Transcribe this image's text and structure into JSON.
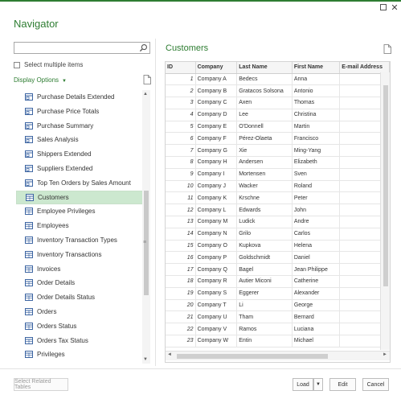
{
  "window": {
    "title": "Navigator",
    "maximize_icon": "maximize-icon",
    "close_glyph": "✕"
  },
  "left": {
    "search": {
      "value": "",
      "placeholder": ""
    },
    "select_multiple_label": "Select multiple items",
    "display_options_label": "Display Options",
    "display_options_caret": "▼",
    "items": [
      {
        "label": "Purchase Details Extended",
        "icon": "view-icon"
      },
      {
        "label": "Purchase Price Totals",
        "icon": "view-icon"
      },
      {
        "label": "Purchase Summary",
        "icon": "view-icon"
      },
      {
        "label": "Sales Analysis",
        "icon": "view-icon"
      },
      {
        "label": "Shippers Extended",
        "icon": "view-icon"
      },
      {
        "label": "Suppliers Extended",
        "icon": "view-icon"
      },
      {
        "label": "Top Ten Orders by Sales Amount",
        "icon": "view-icon"
      },
      {
        "label": "Customers",
        "icon": "table-icon",
        "selected": true
      },
      {
        "label": "Employee Privileges",
        "icon": "table-icon"
      },
      {
        "label": "Employees",
        "icon": "table-icon"
      },
      {
        "label": "Inventory Transaction Types",
        "icon": "table-icon"
      },
      {
        "label": "Inventory Transactions",
        "icon": "table-icon"
      },
      {
        "label": "Invoices",
        "icon": "table-icon"
      },
      {
        "label": "Order Details",
        "icon": "table-icon"
      },
      {
        "label": "Order Details Status",
        "icon": "table-icon"
      },
      {
        "label": "Orders",
        "icon": "table-icon"
      },
      {
        "label": "Orders Status",
        "icon": "table-icon"
      },
      {
        "label": "Orders Tax Status",
        "icon": "table-icon"
      },
      {
        "label": "Privileges",
        "icon": "table-icon"
      }
    ]
  },
  "preview": {
    "title": "Customers",
    "columns": [
      "ID",
      "Company",
      "Last Name",
      "First Name",
      "E-mail Address"
    ],
    "rows": [
      [
        "1",
        "Company A",
        "Bedecs",
        "Anna",
        "..."
      ],
      [
        "2",
        "Company B",
        "Gratacos Solsona",
        "Antonio",
        "..."
      ],
      [
        "3",
        "Company C",
        "Axen",
        "Thomas",
        "..."
      ],
      [
        "4",
        "Company D",
        "Lee",
        "Christina",
        "..."
      ],
      [
        "5",
        "Company E",
        "O'Donnell",
        "Martin",
        "..."
      ],
      [
        "6",
        "Company F",
        "Pérez-Olaeta",
        "Francisco",
        "..."
      ],
      [
        "7",
        "Company G",
        "Xie",
        "Ming-Yang",
        "..."
      ],
      [
        "8",
        "Company H",
        "Andersen",
        "Elizabeth",
        "..."
      ],
      [
        "9",
        "Company I",
        "Mortensen",
        "Sven",
        "..."
      ],
      [
        "10",
        "Company J",
        "Wacker",
        "Roland",
        "..."
      ],
      [
        "11",
        "Company K",
        "Krschne",
        "Peter",
        "..."
      ],
      [
        "12",
        "Company L",
        "Edwards",
        "John",
        "..."
      ],
      [
        "13",
        "Company M",
        "Ludick",
        "Andre",
        "..."
      ],
      [
        "14",
        "Company N",
        "Grilo",
        "Carlos",
        "..."
      ],
      [
        "15",
        "Company O",
        "Kupkova",
        "Helena",
        "..."
      ],
      [
        "16",
        "Company P",
        "Goldschmidt",
        "Daniel",
        "..."
      ],
      [
        "17",
        "Company Q",
        "Bagel",
        "Jean Philippe",
        "..."
      ],
      [
        "18",
        "Company R",
        "Autier Miconi",
        "Catherine",
        "..."
      ],
      [
        "19",
        "Company S",
        "Eggerer",
        "Alexander",
        "..."
      ],
      [
        "20",
        "Company T",
        "Li",
        "George",
        "..."
      ],
      [
        "21",
        "Company U",
        "Tham",
        "Bernard",
        "..."
      ],
      [
        "22",
        "Company V",
        "Ramos",
        "Luciana",
        "..."
      ],
      [
        "23",
        "Company W",
        "Entin",
        "Michael",
        "..."
      ]
    ]
  },
  "footer": {
    "select_related_label": "Select Related Tables",
    "load_label": "Load",
    "load_arrow": "▼",
    "edit_label": "Edit",
    "cancel_label": "Cancel"
  },
  "colors": {
    "accent": "#2e7d32",
    "selected_row": "#cce8cf",
    "grid_border": "#d4d4d4"
  }
}
